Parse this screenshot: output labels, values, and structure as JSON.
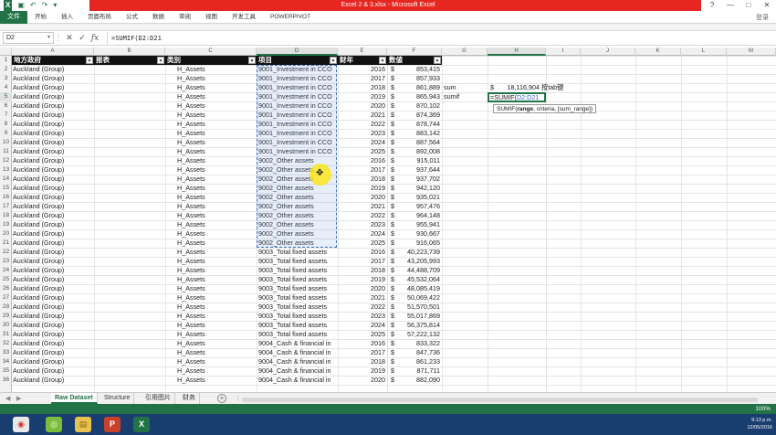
{
  "window": {
    "title": "Excel 2 & 3.xlsx - Microsoft Excel",
    "controls": [
      "?",
      "—",
      "□",
      "✕"
    ]
  },
  "ribbon": {
    "file_tab": "文件",
    "tabs": [
      "开始",
      "插入",
      "页面布局",
      "公式",
      "数据",
      "审阅",
      "视图",
      "开发工具",
      "POWERPIVOT"
    ],
    "login": "登录"
  },
  "formula_bar": {
    "name_box": "D2",
    "formula": "=SUMIF(D2:D21"
  },
  "columns": [
    "A",
    "B",
    "C",
    "D",
    "E",
    "F",
    "G",
    "H",
    "I",
    "J",
    "K",
    "L",
    "M"
  ],
  "row_numbers": [
    "1",
    "2",
    "3",
    "4",
    "5",
    "6",
    "7",
    "8",
    "9",
    "10",
    "11",
    "12",
    "13",
    "14",
    "15",
    "16",
    "17",
    "18",
    "19",
    "20",
    "21",
    "22",
    "23",
    "24",
    "25",
    "26",
    "27",
    "28",
    "29",
    "30",
    "31",
    "32",
    "33",
    "34",
    "35",
    "36"
  ],
  "table": {
    "headers": [
      "地方政府",
      "报表",
      "类別",
      "项目",
      "财年",
      "数値"
    ],
    "rows": [
      [
        "Auckland (Group)",
        "H_Assets",
        "9001_Investment in CCO",
        "2016",
        "853,415"
      ],
      [
        "Auckland (Group)",
        "H_Assets",
        "9001_Investment in CCO",
        "2017",
        "857,933"
      ],
      [
        "Auckland (Group)",
        "H_Assets",
        "9001_Investment in CCO",
        "2018",
        "861,889"
      ],
      [
        "Auckland (Group)",
        "H_Assets",
        "9001_Investment in CCO",
        "2019",
        "865,943"
      ],
      [
        "Auckland (Group)",
        "H_Assets",
        "9001_Investment in CCO",
        "2020",
        "870,102"
      ],
      [
        "Auckland (Group)",
        "H_Assets",
        "9001_Investment in CCO",
        "2021",
        "874,369"
      ],
      [
        "Auckland (Group)",
        "H_Assets",
        "9001_Investment in CCO",
        "2022",
        "878,744"
      ],
      [
        "Auckland (Group)",
        "H_Assets",
        "9001_Investment in CCO",
        "2023",
        "883,142"
      ],
      [
        "Auckland (Group)",
        "H_Assets",
        "9001_Investment in CCO",
        "2024",
        "887,564"
      ],
      [
        "Auckland (Group)",
        "H_Assets",
        "9001_Investment in CCO",
        "2025",
        "892,008"
      ],
      [
        "Auckland (Group)",
        "H_Assets",
        "9002_Other assets",
        "2016",
        "915,011"
      ],
      [
        "Auckland (Group)",
        "H_Assets",
        "9002_Other assets",
        "2017",
        "937,644"
      ],
      [
        "Auckland (Group)",
        "H_Assets",
        "9002_Other assets",
        "2018",
        "937,702"
      ],
      [
        "Auckland (Group)",
        "H_Assets",
        "9002_Other assets",
        "2019",
        "942,120"
      ],
      [
        "Auckland (Group)",
        "H_Assets",
        "9002_Other assets",
        "2020",
        "935,021"
      ],
      [
        "Auckland (Group)",
        "H_Assets",
        "9002_Other assets",
        "2021",
        "957,476"
      ],
      [
        "Auckland (Group)",
        "H_Assets",
        "9002_Other assets",
        "2022",
        "964,148"
      ],
      [
        "Auckland (Group)",
        "H_Assets",
        "9002_Other assets",
        "2023",
        "955,941"
      ],
      [
        "Auckland (Group)",
        "H_Assets",
        "9002_Other assets",
        "2024",
        "930,667"
      ],
      [
        "Auckland (Group)",
        "H_Assets",
        "9002_Other assets",
        "2025",
        "916,065"
      ],
      [
        "Auckland (Group)",
        "H_Assets",
        "9003_Total fixed assets",
        "2016",
        "40,223,739"
      ],
      [
        "Auckland (Group)",
        "H_Assets",
        "9003_Total fixed assets",
        "2017",
        "43,205,993"
      ],
      [
        "Auckland (Group)",
        "H_Assets",
        "9003_Total fixed assets",
        "2018",
        "44,488,709"
      ],
      [
        "Auckland (Group)",
        "H_Assets",
        "9003_Total fixed assets",
        "2019",
        "45,532,064"
      ],
      [
        "Auckland (Group)",
        "H_Assets",
        "9003_Total fixed assets",
        "2020",
        "48,085,419"
      ],
      [
        "Auckland (Group)",
        "H_Assets",
        "9003_Total fixed assets",
        "2021",
        "50,069,422"
      ],
      [
        "Auckland (Group)",
        "H_Assets",
        "9003_Total fixed assets",
        "2022",
        "51,570,501"
      ],
      [
        "Auckland (Group)",
        "H_Assets",
        "9003_Total fixed assets",
        "2023",
        "55,017,869"
      ],
      [
        "Auckland (Group)",
        "H_Assets",
        "9003_Total fixed assets",
        "2024",
        "56,375,814"
      ],
      [
        "Auckland (Group)",
        "H_Assets",
        "9003_Total fixed assets",
        "2025",
        "57,222,132"
      ],
      [
        "Auckland (Group)",
        "H_Assets",
        "9004_Cash & financial in",
        "2016",
        "833,322"
      ],
      [
        "Auckland (Group)",
        "H_Assets",
        "9004_Cash & financial in",
        "2017",
        "847,736"
      ],
      [
        "Auckland (Group)",
        "H_Assets",
        "9004_Cash & financial in",
        "2018",
        "861,233"
      ],
      [
        "Auckland (Group)",
        "H_Assets",
        "9004_Cash & financial in",
        "2019",
        "871,711"
      ],
      [
        "Auckland (Group)",
        "H_Assets",
        "9004_Cash & financial in",
        "2020",
        "882,090"
      ]
    ],
    "currency_symbol": "$"
  },
  "side_calc": {
    "sum_label": "sum",
    "sum_currency": "$",
    "sum_value": "18,116,904",
    "sum_note": "按tab键",
    "sumif_label": "sumif",
    "active_cell_text": "=SUMIF(",
    "active_cell_ref": "D2:D21",
    "tooltip_func": "SUMIF(",
    "tooltip_arg1": "range",
    "tooltip_rest": ", criteria, [sum_range])"
  },
  "sheet_tabs": {
    "tabs": [
      "Raw Dataset",
      "Structure",
      "引用图片",
      "财务"
    ],
    "active": "Raw Dataset",
    "add": "+"
  },
  "status": {
    "zoom": "100%"
  },
  "taskbar": {
    "icons": [
      "chrome-icon",
      "wechat-icon",
      "folder-icon",
      "powerpoint-icon",
      "excel-icon"
    ],
    "clock_time": "9:13 p.m.",
    "clock_date": "12/05/2016"
  },
  "colors": {
    "excel_green": "#217346",
    "title_red": "#e62620",
    "header_black": "#111111",
    "selection_blue": "#3a6fbf",
    "taskbar_blue": "#1a3d70"
  }
}
